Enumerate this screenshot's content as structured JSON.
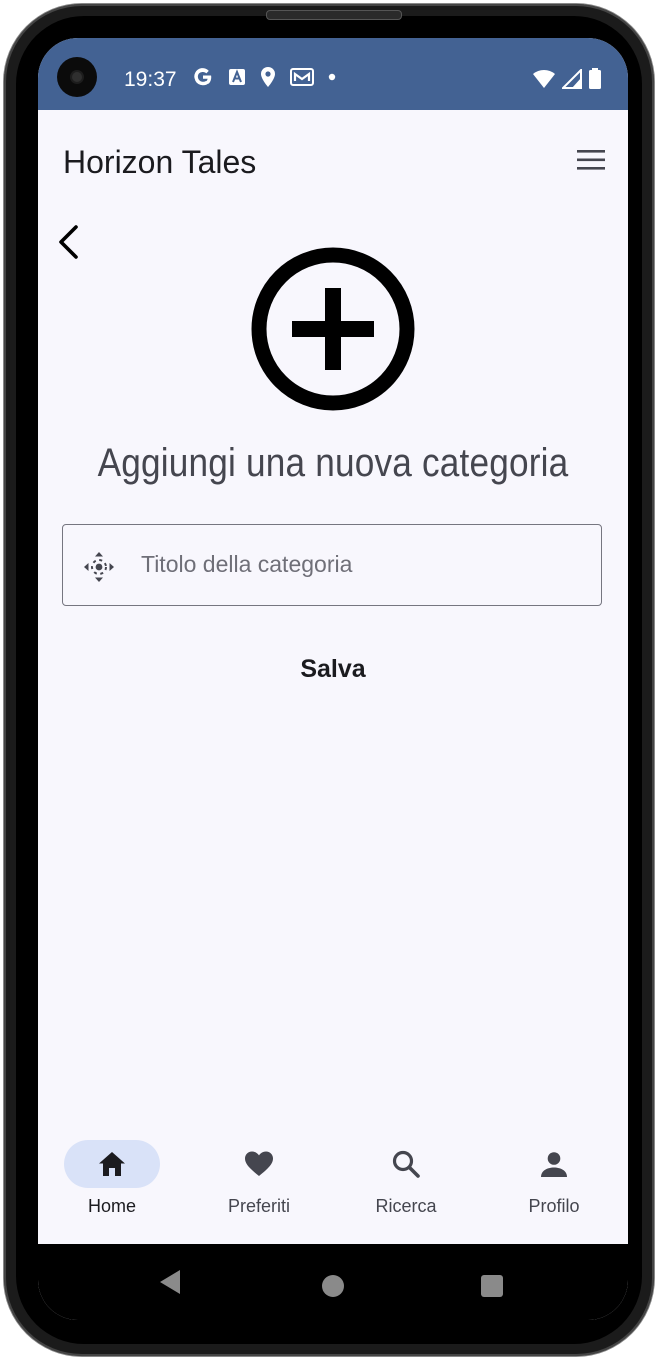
{
  "status_bar": {
    "time": "19:37",
    "left_icons": [
      "google-icon",
      "text-a-icon",
      "location-icon",
      "gmail-icon",
      "dot-icon"
    ],
    "right_icons": [
      "wifi-icon",
      "signal-icon",
      "battery-icon"
    ],
    "background": "#436293"
  },
  "app_bar": {
    "title": "Horizon Tales"
  },
  "main": {
    "heading": "Aggiungi una nuova categoria",
    "title_field": {
      "value": "",
      "placeholder": "Titolo della categoria"
    },
    "save_label": "Salva"
  },
  "bottom_nav": {
    "items": [
      {
        "label": "Home",
        "icon": "home-icon",
        "active": true
      },
      {
        "label": "Preferiti",
        "icon": "heart-icon",
        "active": false
      },
      {
        "label": "Ricerca",
        "icon": "search-icon",
        "active": false
      },
      {
        "label": "Profilo",
        "icon": "person-icon",
        "active": false
      }
    ]
  },
  "colors": {
    "screen_background": "#f8f7fd",
    "active_nav_pill": "#d9e2f8"
  }
}
